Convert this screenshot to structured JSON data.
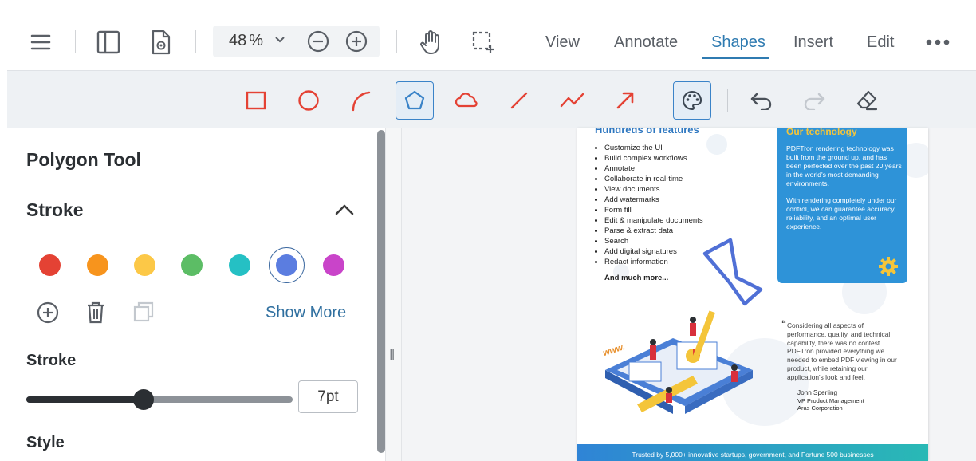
{
  "toolbar": {
    "zoom_value": "48",
    "zoom_unit": "%",
    "tabs": [
      {
        "label": "View"
      },
      {
        "label": "Annotate"
      },
      {
        "label": "Shapes"
      },
      {
        "label": "Insert"
      },
      {
        "label": "Edit"
      }
    ],
    "active_tab": "Shapes"
  },
  "shapes_bar": {
    "tools": [
      "rectangle-icon",
      "ellipse-icon",
      "arc-icon",
      "polygon-icon",
      "cloud-icon",
      "line-icon",
      "polyline-icon",
      "arrow-icon"
    ],
    "selected_tool": "polygon-icon",
    "tool_color": "#e44234"
  },
  "panel": {
    "title": "Polygon Tool",
    "stroke_section": "Stroke",
    "colors": [
      "#e44234",
      "#f7941d",
      "#fcc847",
      "#5cbd65",
      "#25c0c4",
      "#5b7de0",
      "#c944c9"
    ],
    "selected_color": "#5b7de0",
    "show_more": "Show More",
    "stroke_label": "Stroke",
    "stroke_value": "7pt",
    "stroke_fraction": 0.44,
    "style_label": "Style"
  },
  "document": {
    "heading": "Hundreds of features",
    "features": [
      "Customize the UI",
      "Build complex workflows",
      "Annotate",
      "Collaborate in real-time",
      "View documents",
      "Add watermarks",
      "Form fill",
      "Edit & manipulate documents",
      "Parse & extract data",
      "Search",
      "Add digital signatures",
      "Redact information"
    ],
    "more": "And much more...",
    "card_title": "Our technology",
    "card_p1": "PDFTron rendering technology was built from the ground up, and has been perfected over the past 20 years in the world's most demanding environments.",
    "card_p2": "With rendering completely under our control, we can guarantee accuracy, reliability, and an optimal user experience.",
    "quote": "Considering all aspects of performance, quality, and technical capability, there was no contest. PDFTron provided everything we needed to embed PDF viewing in our product, while retaining our application's look and feel.",
    "quote_author": "John Sperling",
    "quote_role": "VP Product Management",
    "quote_company": "Aras Corporation",
    "www": "www.",
    "footer": "Trusted by 5,000+ innovative startups, government, and Fortune 500 businesses"
  }
}
